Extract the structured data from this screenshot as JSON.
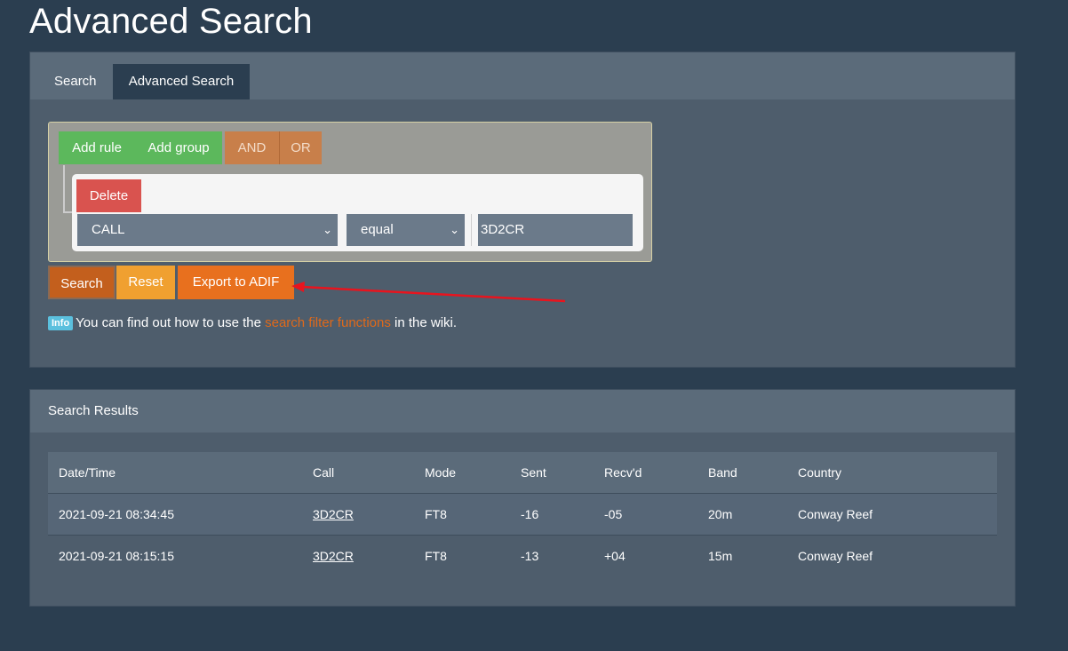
{
  "page": {
    "title": "Advanced Search"
  },
  "tabs": [
    {
      "label": "Search"
    },
    {
      "label": "Advanced Search"
    }
  ],
  "query_builder": {
    "add_rule": "Add rule",
    "add_group": "Add group",
    "and": "AND",
    "or": "OR",
    "delete": "Delete",
    "field": "CALL",
    "operator": "equal",
    "value": "3D2CR"
  },
  "actions": {
    "search": "Search",
    "reset": "Reset",
    "export": "Export to ADIF"
  },
  "info": {
    "badge": "Info",
    "text_before": "You can find out how to use the ",
    "link": "search filter functions",
    "text_after": " in the wiki."
  },
  "results": {
    "title": "Search Results",
    "columns": [
      "Date/Time",
      "Call",
      "Mode",
      "Sent",
      "Recv'd",
      "Band",
      "Country"
    ],
    "rows": [
      {
        "datetime": "2021-09-21 08:34:45",
        "call": "3D2CR",
        "mode": "FT8",
        "sent": "-16",
        "recvd": "-05",
        "band": "20m",
        "country": "Conway Reef"
      },
      {
        "datetime": "2021-09-21 08:15:15",
        "call": "3D2CR",
        "mode": "FT8",
        "sent": "-13",
        "recvd": "+04",
        "band": "15m",
        "country": "Conway Reef"
      }
    ]
  },
  "colors": {
    "background": "#2b3e50",
    "card": "#4e5d6c",
    "accent": "#df691a",
    "success": "#5cb85c",
    "danger": "#d9534f",
    "annotation_arrow": "#e8141e"
  }
}
